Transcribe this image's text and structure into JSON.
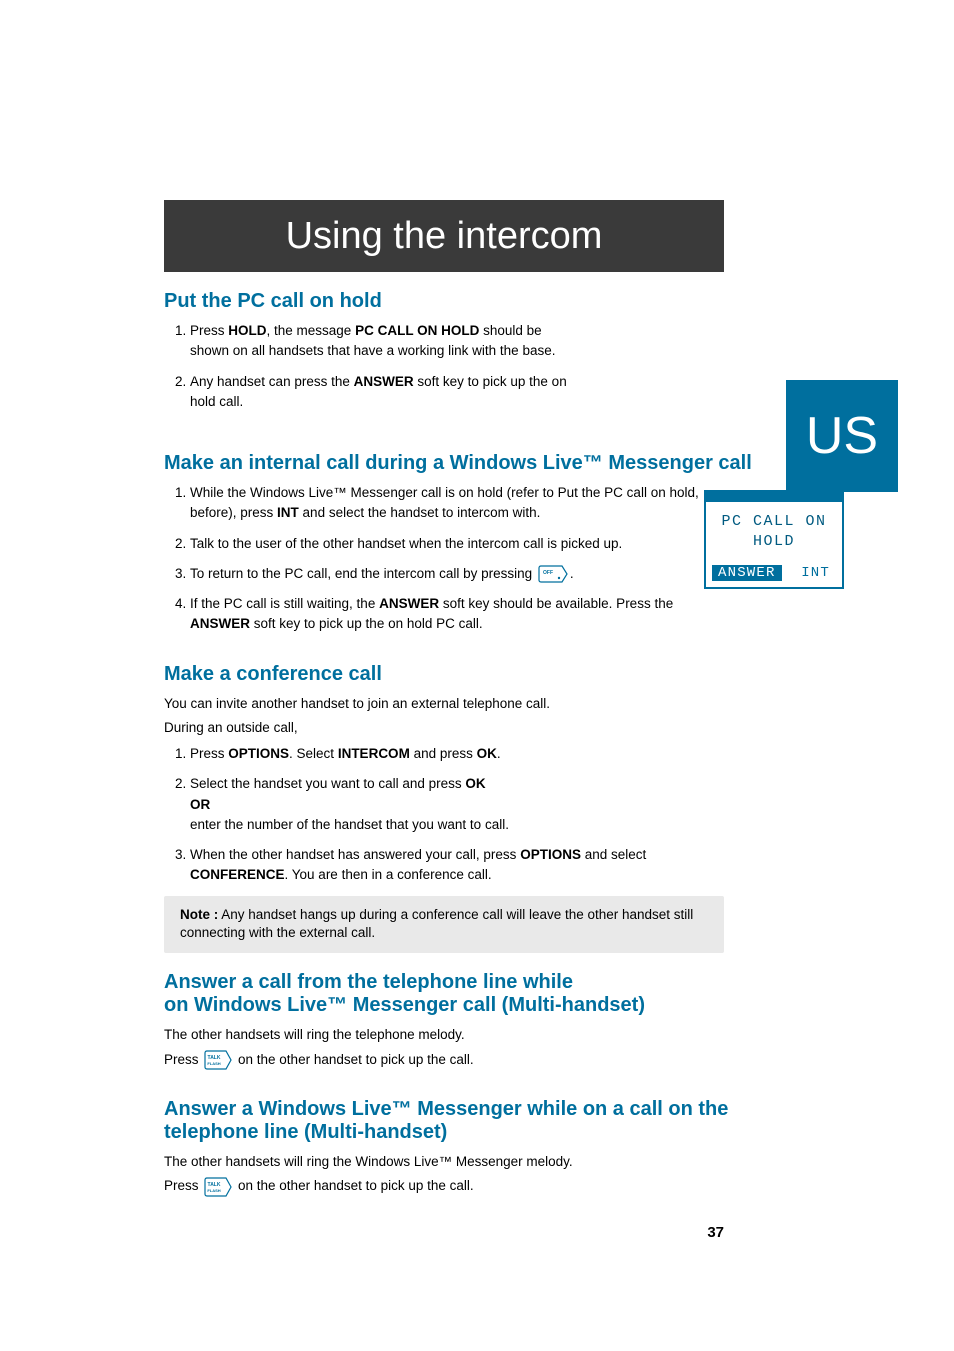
{
  "header": {
    "title": "Using the intercom",
    "country": "US"
  },
  "phone_screen": {
    "line1": "PC CALL ON",
    "line2": "HOLD",
    "soft_left": "ANSWER",
    "soft_right": "INT"
  },
  "sections": {
    "hold": {
      "title": "Put the PC call on hold",
      "step1_a": "Press ",
      "step1_b": "HOLD",
      "step1_c": ", the message ",
      "step1_d": "PC CALL ON HOLD",
      "step1_e": " should be shown on all handsets that have a working link with the base.",
      "step2_a": "Any handset can press the ",
      "step2_b": "ANSWER",
      "step2_c": " soft key to pick up the on hold call."
    },
    "internal": {
      "title": "Make an internal call during a Windows Live™ Messenger call",
      "step1_a": "While the Windows Live™ Messenger call is on hold (refer to Put the PC call on hold, before), press ",
      "step1_b": "INT",
      "step1_c": " and select the handset to intercom with.",
      "step2": "Talk to the user of the other handset when the intercom call is picked up.",
      "step3": "To return to the PC call, end the intercom call by pressing ",
      "step3_end": ".",
      "step4_a": "If the PC call is still waiting, the ",
      "step4_b": "ANSWER",
      "step4_c": " soft key should be available. Press the ",
      "step4_d": "ANSWER",
      "step4_e": " soft key to pick up the on hold PC call."
    },
    "conference": {
      "title": "Make a conference call",
      "intro1": "You can invite another handset to join an external telephone call.",
      "intro2": "During an outside call,",
      "step1_a": "Press ",
      "step1_b": "OPTIONS",
      "step1_c": ". Select ",
      "step1_d": "INTERCOM",
      "step1_e": " and press ",
      "step1_f": "OK",
      "step1_g": ".",
      "step2_a": "Select the handset you want to call and press ",
      "step2_b": "OK",
      "step2_br": "OR",
      "step2_c": "enter the number of the handset that you want to call.",
      "step3_a": "When the other handset has answered your call, press ",
      "step3_b": "OPTIONS",
      "step3_c": " and select ",
      "step3_d": "CONFERENCE",
      "step3_e": ". You are then in a conference call.",
      "note_label": "Note :",
      "note_text": " Any handset hangs up during a conference call will leave the other handset still connecting with the external call."
    },
    "answer_tel": {
      "title_line1": "Answer a call from the telephone line while",
      "title_line2": "on Windows Live™ Messenger call (Multi-handset)",
      "body1": "The other handsets will ring the telephone melody.",
      "body2_a": "Press ",
      "body2_b": " on the other handset to pick up the call."
    },
    "answer_wlm": {
      "title_line1": "Answer a Windows Live™ Messenger while on a call on the",
      "title_line2": "telephone line (Multi-handset)",
      "body1": "The other handsets will ring the Windows Live™ Messenger melody.",
      "body2_a": "Press ",
      "body2_b": " on the other handset to pick up the call."
    }
  },
  "page_number": "37",
  "icon_labels": {
    "off": "OFF",
    "talk1": "TALK",
    "talk2": "FLASH"
  }
}
